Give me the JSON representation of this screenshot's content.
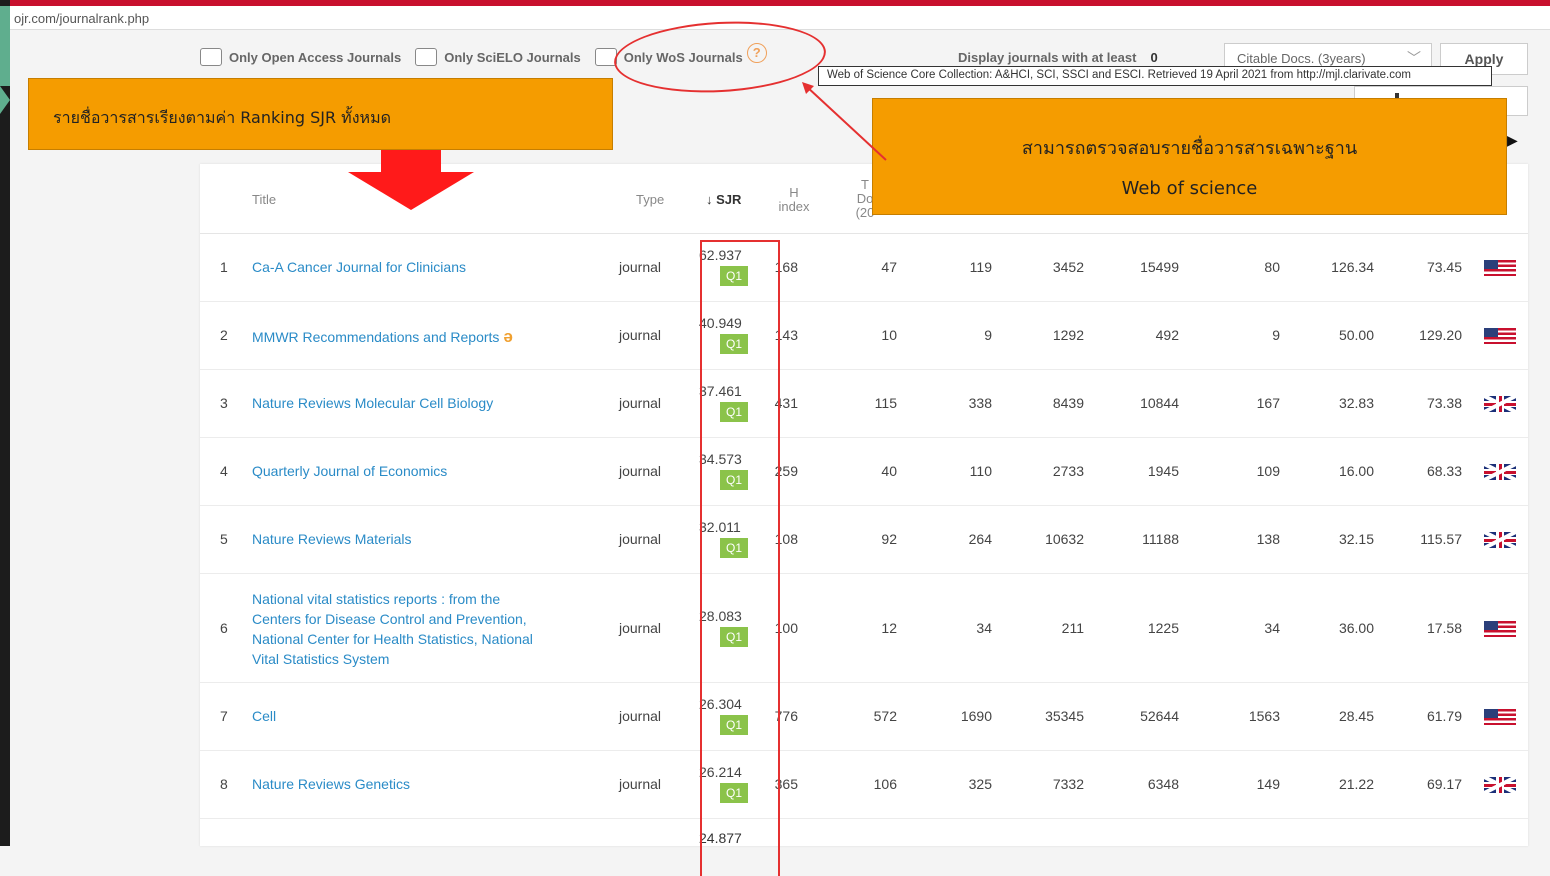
{
  "url": "ojr.com/journalrank.php",
  "filters": {
    "open_access": "Only Open Access Journals",
    "scielo": "Only SciELO Journals",
    "wos": "Only WoS Journals",
    "help": "?",
    "display_label": "Display journals with at least",
    "display_value": "0",
    "select_value": "Citable Docs. (3years)",
    "apply": "Apply"
  },
  "tooltip": "Web of Science Core Collection: A&HCI, SCI, SSCI and ESCI. Retrieved 19 April 2021 from http://mjl.clarivate.com",
  "annotations": {
    "left": "รายชื่อวารสารเรียงตามค่า Ranking SJR ทั้งหมด",
    "right_line1": "สามารถตรวจสอบรายชื่อวารสารเฉพาะฐาน",
    "right_line2": "Web of science"
  },
  "headers": {
    "title": "Title",
    "type": "Type",
    "sjr": "↓ SJR",
    "h_index_1": "H",
    "h_index_2": "index",
    "total_docs_1": "T",
    "total_docs_2": "Do",
    "total_docs_3": "(20"
  },
  "rows": [
    {
      "rank": "1",
      "title": "Ca-A Cancer Journal for Clinicians",
      "type": "journal",
      "sjr": "62.937",
      "q": "Q1",
      "h": "168",
      "docs": "47",
      "docs3": "119",
      "refs": "3452",
      "cites3": "15499",
      "citable3": "80",
      "cpd": "126.34",
      "refpd": "73.45",
      "country": "us"
    },
    {
      "rank": "2",
      "title": "MMWR Recommendations and Reports",
      "type": "journal",
      "sjr": "40.949",
      "q": "Q1",
      "h": "143",
      "docs": "10",
      "docs3": "9",
      "refs": "1292",
      "cites3": "492",
      "citable3": "9",
      "cpd": "50.00",
      "refpd": "129.20",
      "country": "us",
      "oa": true
    },
    {
      "rank": "3",
      "title": "Nature Reviews Molecular Cell Biology",
      "type": "journal",
      "sjr": "37.461",
      "q": "Q1",
      "h": "431",
      "docs": "115",
      "docs3": "338",
      "refs": "8439",
      "cites3": "10844",
      "citable3": "167",
      "cpd": "32.83",
      "refpd": "73.38",
      "country": "uk"
    },
    {
      "rank": "4",
      "title": "Quarterly Journal of Economics",
      "type": "journal",
      "sjr": "34.573",
      "q": "Q1",
      "h": "259",
      "docs": "40",
      "docs3": "110",
      "refs": "2733",
      "cites3": "1945",
      "citable3": "109",
      "cpd": "16.00",
      "refpd": "68.33",
      "country": "uk"
    },
    {
      "rank": "5",
      "title": "Nature Reviews Materials",
      "type": "journal",
      "sjr": "32.011",
      "q": "Q1",
      "h": "108",
      "docs": "92",
      "docs3": "264",
      "refs": "10632",
      "cites3": "11188",
      "citable3": "138",
      "cpd": "32.15",
      "refpd": "115.57",
      "country": "uk"
    },
    {
      "rank": "6",
      "title_lines": [
        "National vital statistics reports : from the",
        "Centers for Disease Control and Prevention,",
        "National Center for Health Statistics, National",
        "Vital Statistics System"
      ],
      "type": "journal",
      "sjr": "28.083",
      "q": "Q1",
      "h": "100",
      "docs": "12",
      "docs3": "34",
      "refs": "211",
      "cites3": "1225",
      "citable3": "34",
      "cpd": "36.00",
      "refpd": "17.58",
      "country": "us"
    },
    {
      "rank": "7",
      "title": "Cell",
      "type": "journal",
      "sjr": "26.304",
      "q": "Q1",
      "h": "776",
      "docs": "572",
      "docs3": "1690",
      "refs": "35345",
      "cites3": "52644",
      "citable3": "1563",
      "cpd": "28.45",
      "refpd": "61.79",
      "country": "us"
    },
    {
      "rank": "8",
      "title": "Nature Reviews Genetics",
      "type": "journal",
      "sjr": "26.214",
      "q": "Q1",
      "h": "365",
      "docs": "106",
      "docs3": "325",
      "refs": "7332",
      "cites3": "6348",
      "citable3": "149",
      "cpd": "21.22",
      "refpd": "69.17",
      "country": "uk"
    }
  ],
  "partial_sjr": "24.877"
}
